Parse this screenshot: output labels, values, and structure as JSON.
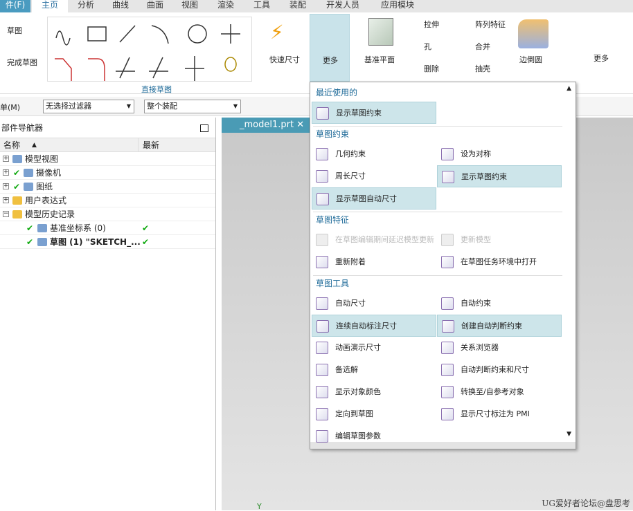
{
  "tabs": [
    "件(F)",
    "主页",
    "分析",
    "曲线",
    "曲面",
    "视图",
    "渲染",
    "工具",
    "装配",
    "开发人员",
    "应用模块"
  ],
  "ribbon": {
    "sketch": "草图",
    "finish_sketch": "完成草图",
    "group_label": "直接草图",
    "quick_dim": "快速尺寸",
    "more": "更多",
    "datum_plane": "基准平面",
    "extrude": "拉伸",
    "pattern": "阵列特征",
    "hole": "孔",
    "unite": "合并",
    "delete": "删除",
    "shell": "抽壳",
    "edge_blend": "边倒圆",
    "more2": "更多"
  },
  "toolbar": {
    "menu": "单(M)",
    "filter": "无选择过滤器",
    "scope": "整个装配"
  },
  "nav": {
    "title": "部件导航器",
    "col_name": "名称",
    "col_latest": "最新",
    "rows": [
      {
        "label": "模型视图",
        "expander": "+",
        "check": false,
        "latest": ""
      },
      {
        "label": "摄像机",
        "expander": "+",
        "check": true,
        "latest": ""
      },
      {
        "label": "图纸",
        "expander": "+",
        "check": true,
        "latest": ""
      },
      {
        "label": "用户表达式",
        "expander": "+",
        "check": false,
        "latest": ""
      },
      {
        "label": "模型历史记录",
        "expander": "−",
        "check": false,
        "latest": ""
      },
      {
        "label": "基准坐标系 (0)",
        "expander": "",
        "check": true,
        "latest": "✔",
        "child": true
      },
      {
        "label": "草图 (1) \"SKETCH_...",
        "expander": "",
        "check": true,
        "latest": "✔",
        "child": true,
        "bold": true
      }
    ]
  },
  "graphics": {
    "tab": "_model1.prt",
    "axis": "Y",
    "watermark": "UG爱好者论坛@盘思考"
  },
  "menu": {
    "sections": [
      {
        "title": "最近使用的",
        "items": [
          {
            "label": "显示草图约束",
            "hl": true
          }
        ]
      },
      {
        "title": "草图约束",
        "items": [
          {
            "label": "几何约束"
          },
          {
            "label": "设为对称"
          },
          {
            "label": "周长尺寸"
          },
          {
            "label": "显示草图约束",
            "hl": true
          },
          {
            "label": "显示草图自动尺寸",
            "hl": true
          }
        ]
      },
      {
        "title": "草图特征",
        "items": [
          {
            "label": "在草图编辑期间延迟模型更新",
            "dis": true
          },
          {
            "label": "更新模型",
            "dis": true
          },
          {
            "label": "重新附着"
          },
          {
            "label": "在草图任务环境中打开"
          }
        ]
      },
      {
        "title": "草图工具",
        "items": [
          {
            "label": "自动尺寸"
          },
          {
            "label": "自动约束"
          },
          {
            "label": "连续自动标注尺寸",
            "hl": true
          },
          {
            "label": "创建自动判断约束",
            "hl": true
          },
          {
            "label": "动画演示尺寸"
          },
          {
            "label": "关系浏览器"
          },
          {
            "label": "备选解"
          },
          {
            "label": "自动判断约束和尺寸"
          },
          {
            "label": "显示对象颜色"
          },
          {
            "label": "转换至/自参考对象"
          },
          {
            "label": "定向到草图"
          },
          {
            "label": "显示尺寸标注为 PMI"
          },
          {
            "label": "编辑草图参数"
          }
        ]
      }
    ]
  }
}
